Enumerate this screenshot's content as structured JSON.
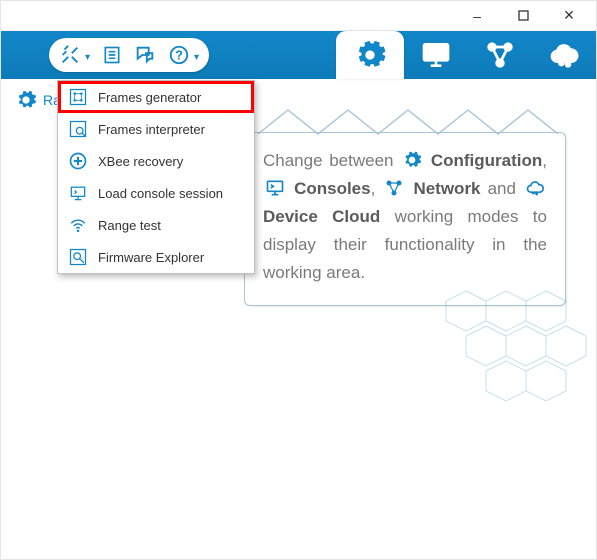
{
  "window": {
    "btn_min": "–",
    "btn_max": "□",
    "btn_close": "×"
  },
  "toolbar": {
    "tools_button": "Tools",
    "list_button": "List",
    "chat_button": "Feedback",
    "help_button": "Help"
  },
  "modes": {
    "configuration": "Configuration",
    "consoles": "Consoles",
    "network": "Network",
    "device_cloud": "Device Cloud"
  },
  "sidebar": {
    "ra_label": "Ra"
  },
  "dropdown": {
    "items": [
      {
        "label": "Frames generator"
      },
      {
        "label": "Frames interpreter"
      },
      {
        "label": "XBee recovery"
      },
      {
        "label": "Load console session"
      },
      {
        "label": "Range test"
      },
      {
        "label": "Firmware Explorer"
      }
    ]
  },
  "info": {
    "t1": "Change between ",
    "b1": "Configuration",
    "t2": ", ",
    "b2": "Consoles",
    "t3": ", ",
    "b3": "Network",
    "t4": " and ",
    "b4": "Device Cloud",
    "t5": " working modes to display their functionality in the working area."
  }
}
